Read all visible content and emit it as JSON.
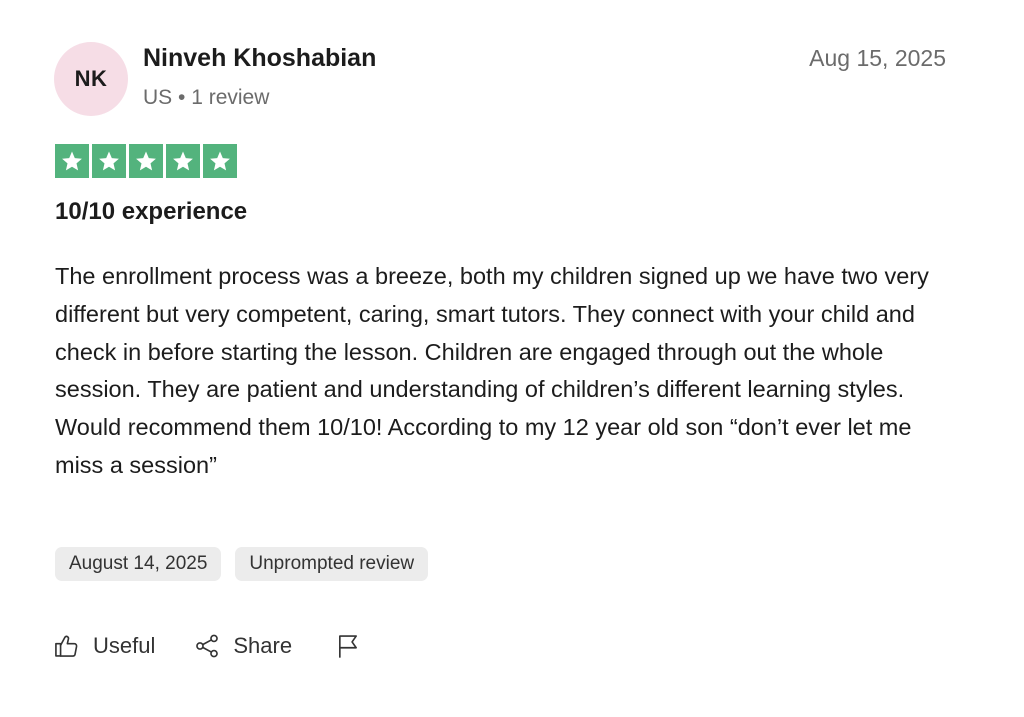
{
  "reviewer": {
    "initials": "NK",
    "name": "Ninveh Khoshabian",
    "meta": "US • 1 review",
    "avatar_color": "#f6dde6"
  },
  "review": {
    "date": "Aug 15, 2025",
    "rating": 5,
    "rating_max": 5,
    "star_color": "#53b37d",
    "title": "10/10 experience",
    "body": "The enrollment process was a breeze, both my children signed up we have two very different but very competent, caring, smart tutors. They connect with your child and check in before starting the lesson. Children are engaged through out the whole session. They are patient and understanding of children’s different learning styles. Would recommend them 10/10! According to my 12 year old son “don’t ever let me miss a session”",
    "tags": [
      "August 14, 2025",
      "Unprompted review"
    ]
  },
  "actions": {
    "useful_label": "Useful",
    "useful_icon": "thumbs-up-icon",
    "share_label": "Share",
    "share_icon": "share-icon",
    "report_icon": "flag-icon"
  }
}
